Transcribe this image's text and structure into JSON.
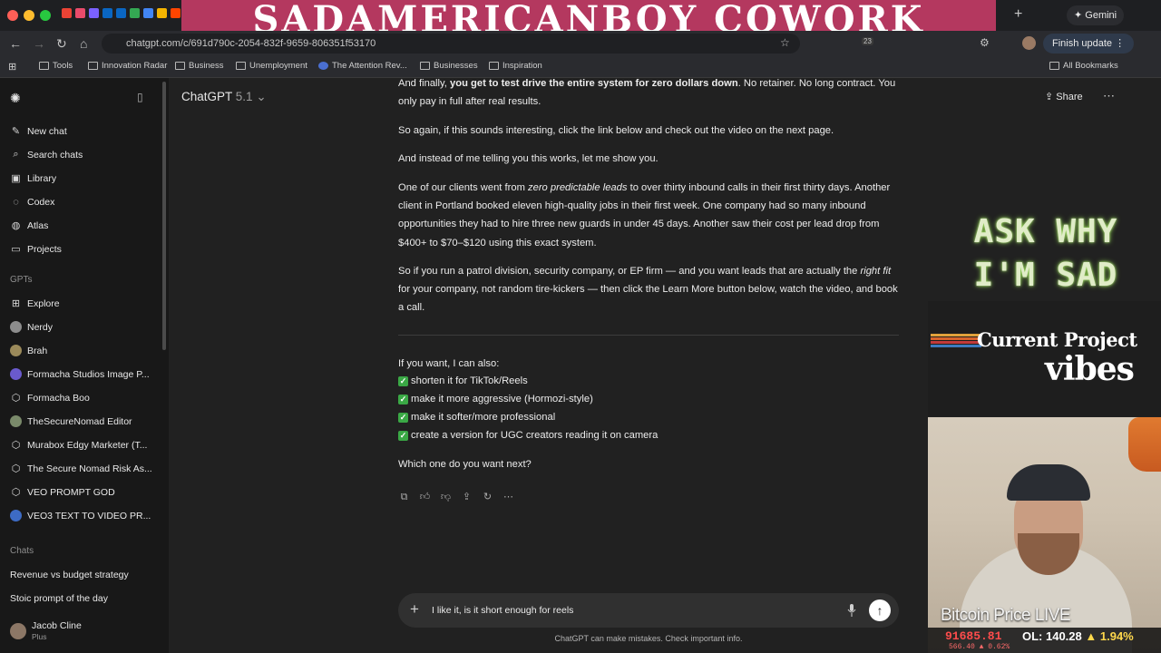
{
  "colors": {
    "banner": "#b4385f",
    "accent": "#ffffff",
    "check": "#3aa845",
    "ticker_red": "#ff4c4c"
  },
  "browser": {
    "url": "chatgpt.com/c/691d790c-2054-832f-9659-806351f53170",
    "gemini_label": "Gemini",
    "finish_update": "Finish update",
    "badge_count": "23",
    "bookmarks": [
      "Tools",
      "Innovation Radar",
      "Business",
      "Unemployment",
      "The Attention Rev...",
      "Businesses",
      "Inspiration"
    ],
    "all_bookmarks": "All Bookmarks"
  },
  "stream_overlay": {
    "banner_title": "SadAmericanBoy Cowork",
    "ask_why_line1": "ASK WHY",
    "ask_why_line2": "I'M SAD",
    "current_project": "Current Project",
    "vibes": "vibes",
    "ticker_title": "Bitcoin Price LIVE",
    "ticker_price": "91685.81",
    "ticker_sub": "566.40 ▲ 0.62%",
    "ticker_ol": "OL: 140.28",
    "ticker_change": "▲ 1.94%"
  },
  "sidebar": {
    "primary": [
      {
        "label": "New chat",
        "icon": "new-chat-icon"
      },
      {
        "label": "Search chats",
        "icon": "search-icon"
      },
      {
        "label": "Library",
        "icon": "library-icon"
      },
      {
        "label": "Codex",
        "icon": "codex-icon"
      },
      {
        "label": "Atlas",
        "icon": "atlas-icon"
      },
      {
        "label": "Projects",
        "icon": "folder-icon"
      }
    ],
    "gpts_heading": "GPTs",
    "gpts": [
      {
        "label": "Explore",
        "icon": "explore-icon"
      },
      {
        "label": "Nerdy",
        "icon": "gpt-avatar"
      },
      {
        "label": "Brah",
        "icon": "gpt-avatar"
      },
      {
        "label": "Formacha Studios Image P...",
        "icon": "gpt-avatar"
      },
      {
        "label": "Formacha Boo",
        "icon": "cube-icon"
      },
      {
        "label": "TheSecureNomad Editor",
        "icon": "gpt-avatar"
      },
      {
        "label": "Murabox Edgy Marketer (T...",
        "icon": "cube-icon"
      },
      {
        "label": "The Secure Nomad Risk As...",
        "icon": "cube-icon"
      },
      {
        "label": "VEO PROMPT GOD",
        "icon": "cube-icon"
      },
      {
        "label": "VEO3 TEXT TO VIDEO PR...",
        "icon": "gpt-avatar"
      }
    ],
    "chats_heading": "Chats",
    "chats": [
      "Revenue vs budget strategy",
      "Stoic prompt of the day"
    ],
    "user_name": "Jacob Cline",
    "user_plan": "Plus"
  },
  "header": {
    "model": "ChatGPT",
    "version": "5.1",
    "share": "Share"
  },
  "message": {
    "p1_prefix": "And finally, ",
    "p1_bold": "you get to test drive the entire system for zero dollars down",
    "p1_suffix": ". No retainer. No long contract. You only pay in full after real results.",
    "p2": "So again, if this sounds interesting, click the link below and check out the video on the next page.",
    "p3": "And instead of me telling you this works, let me show you.",
    "p4_prefix": "One of our clients went from ",
    "p4_italic": "zero predictable leads",
    "p4_suffix": " to over thirty inbound calls in their first thirty days. Another client in Portland booked eleven high-quality jobs in their first week. One company had so many inbound opportunities they had to hire three new guards in under 45 days. Another saw their cost per lead drop from $400+ to $70–$120 using this exact system.",
    "p5_prefix": "So if you run a patrol division, security company, or EP firm — and you want leads that are actually the ",
    "p5_italic": "right fit",
    "p5_suffix": " for your company, not random tire-kickers — then click the Learn More button below, watch the video, and book a call.",
    "options_intro": "If you want, I can also:",
    "options": [
      "shorten it for TikTok/Reels",
      "make it more aggressive (Hormozi-style)",
      "make it softer/more professional",
      "create a version for UGC creators reading it on camera"
    ],
    "closing": "Which one do you want next?"
  },
  "composer": {
    "text": "I like it, is it short enough for reels",
    "disclaimer": "ChatGPT can make mistakes. Check important info."
  }
}
